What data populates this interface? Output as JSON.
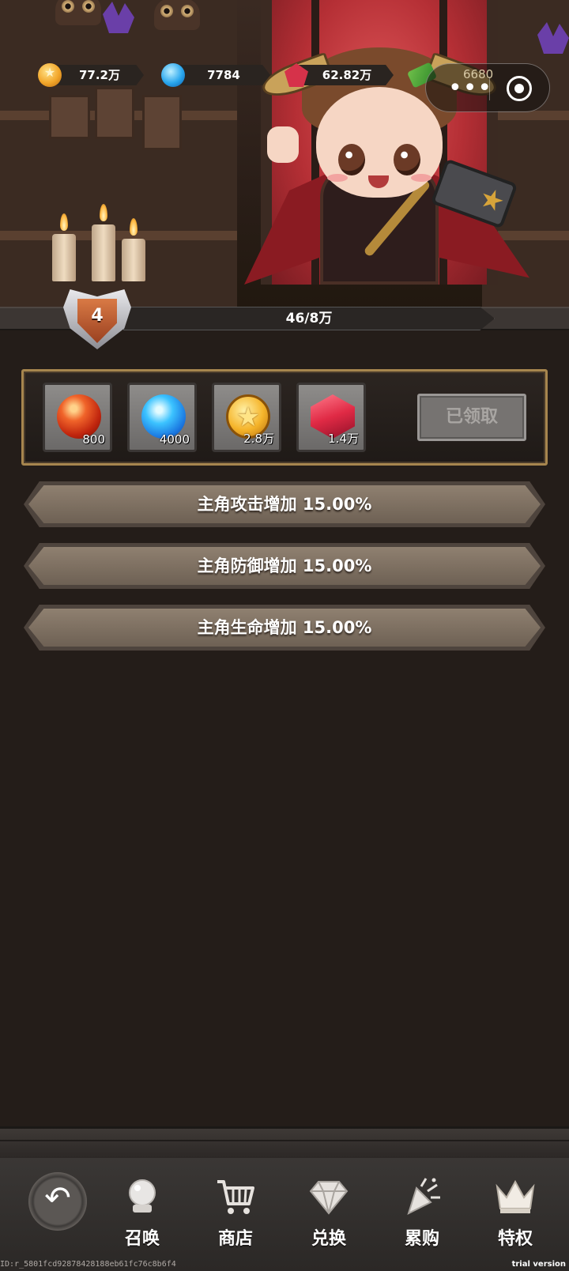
{
  "currencies": [
    {
      "icon": "gold-coin-icon",
      "value": "77.2万"
    },
    {
      "icon": "blue-orb-icon",
      "value": "7784"
    },
    {
      "icon": "red-gem-icon",
      "value": "62.82万"
    },
    {
      "icon": "cash-icon",
      "value": "6680"
    }
  ],
  "capsule": {
    "more_icon": "more-dots-icon",
    "close_icon": "close-target-icon"
  },
  "level": {
    "number": "4",
    "progress_text": "46/8万"
  },
  "rewards": [
    {
      "icon": "fire-orb-icon",
      "amount": "800"
    },
    {
      "icon": "water-orb-icon",
      "amount": "4000"
    },
    {
      "icon": "gold-coin-icon",
      "amount": "2.8万"
    },
    {
      "icon": "red-gem-icon",
      "amount": "1.4万"
    }
  ],
  "claim_button": {
    "label": "已领取",
    "disabled": true
  },
  "bonuses": [
    {
      "text": "主角攻击增加 15.00%"
    },
    {
      "text": "主角防御增加 15.00%"
    },
    {
      "text": "主角生命增加 15.00%"
    }
  ],
  "nav": {
    "back_icon": "back-arrow-icon",
    "items": [
      {
        "label": "召唤",
        "icon": "crystal-ball-icon"
      },
      {
        "label": "商店",
        "icon": "cart-icon"
      },
      {
        "label": "兑换",
        "icon": "diamond-icon"
      },
      {
        "label": "累购",
        "icon": "firework-icon"
      },
      {
        "label": "特权",
        "icon": "crown-icon"
      }
    ]
  },
  "footer": {
    "id_text": "ID:r_5801fcd928784281​88eb61fc76c8b6f4",
    "trial_text": "trial version"
  },
  "colors": {
    "panel_border": "#a7864e",
    "background": "#241d19",
    "bonus_fill": "#7e7062"
  }
}
